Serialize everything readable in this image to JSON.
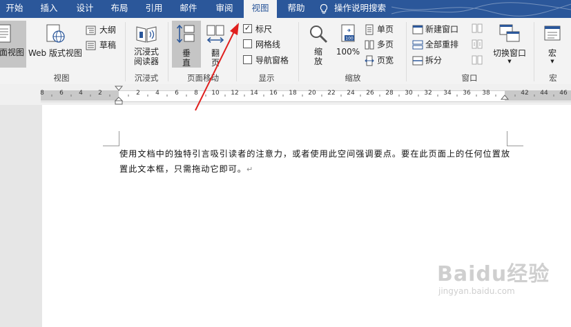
{
  "tabs": [
    {
      "label": "开始"
    },
    {
      "label": "插入"
    },
    {
      "label": "设计"
    },
    {
      "label": "布局"
    },
    {
      "label": "引用"
    },
    {
      "label": "邮件"
    },
    {
      "label": "审阅"
    },
    {
      "label": "视图"
    },
    {
      "label": "帮助"
    }
  ],
  "tell_me": "操作说明搜索",
  "ribbon": {
    "views": {
      "label": "视图",
      "read_mode": "面视图",
      "web_layout": "Web 版式视图",
      "outline": "大纲",
      "draft": "草稿"
    },
    "immersive": {
      "label": "沉浸式",
      "reader_line1": "沉浸式",
      "reader_line2": "阅读器"
    },
    "page_move": {
      "label": "页面移动",
      "vertical_line1": "垂",
      "vertical_line2": "直",
      "side_line1": "翻",
      "side_line2": "页"
    },
    "show": {
      "label": "显示",
      "ruler": "标尺",
      "ruler_checked": true,
      "gridlines": "网格线",
      "gridlines_checked": false,
      "nav_pane": "导航窗格",
      "nav_pane_checked": false
    },
    "zoom": {
      "label": "缩放",
      "zoom_line1": "缩",
      "zoom_line2": "放",
      "hundred": "100%",
      "one_page": "单页",
      "multi_page": "多页",
      "page_width": "页宽"
    },
    "window": {
      "label": "窗口",
      "new_window": "新建窗口",
      "arrange_all": "全部重排",
      "split": "拆分",
      "switch_windows": "切换窗口"
    },
    "macros": {
      "label": "宏",
      "macros_btn": "宏"
    }
  },
  "ruler": {
    "left_numbers": [
      "8",
      "6",
      "4",
      "2"
    ],
    "right_numbers": [
      "2",
      "4",
      "6",
      "8",
      "10",
      "12",
      "14",
      "16",
      "18",
      "20",
      "22",
      "24",
      "26",
      "28",
      "30",
      "32",
      "34",
      "36",
      "38",
      "42",
      "44",
      "46"
    ]
  },
  "document": {
    "paragraph": "使用文档中的独特引言吸引读者的注意力，或者使用此空间强调要点。要在此页面上的任何位置放置此文本框，只需拖动它即可。",
    "paragraph_mark": "↵"
  },
  "watermark": {
    "brand": "Baidu经验",
    "url": "jingyan.baidu.com"
  },
  "colors": {
    "tab_bar": "#2b579a",
    "annotation_arrow": "#e0201e"
  }
}
